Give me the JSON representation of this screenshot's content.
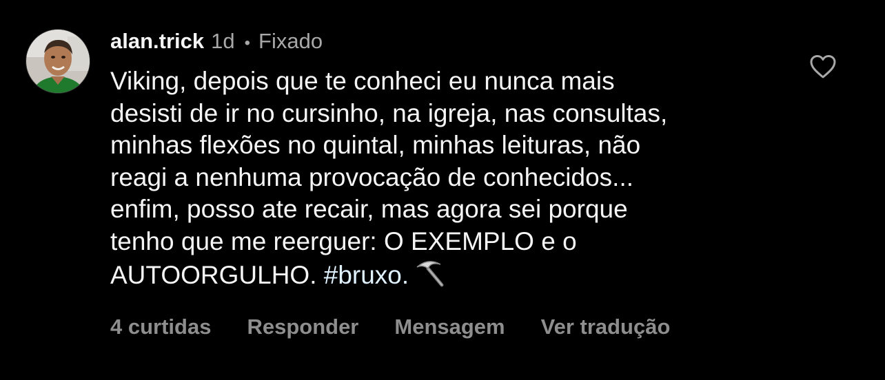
{
  "comment": {
    "author": {
      "username": "alan.trick",
      "avatar_icon": "user-avatar"
    },
    "timestamp": "1d",
    "separator": "•",
    "pinned_label": "Fixado",
    "text_lines": [
      "Viking, depois que te conheci eu nunca mais",
      "desisti de ir no cursinho, na igreja, nas consultas,",
      "minhas flexões no quintal, minhas leituras, não",
      "reagi a nenhuma provocação de conhecidos...",
      "enfim, posso ate recair, mas agora sei porque",
      "tenho que me reerguer: O EXEMPLO e o"
    ],
    "last_line_text": "AUTOORGULHO. ",
    "hashtag": "#bruxo.",
    "emoji_icon": "pick-icon",
    "like_icon": "heart-icon"
  },
  "actions": {
    "likes": "4 curtidas",
    "reply": "Responder",
    "message": "Mensagem",
    "translate": "Ver tradução"
  },
  "colors": {
    "background": "#000000",
    "primary_text": "#f5f5f5",
    "secondary_text": "#a8a8a8",
    "action_text": "#8e8e8e",
    "hashtag": "#e0f1ff"
  }
}
